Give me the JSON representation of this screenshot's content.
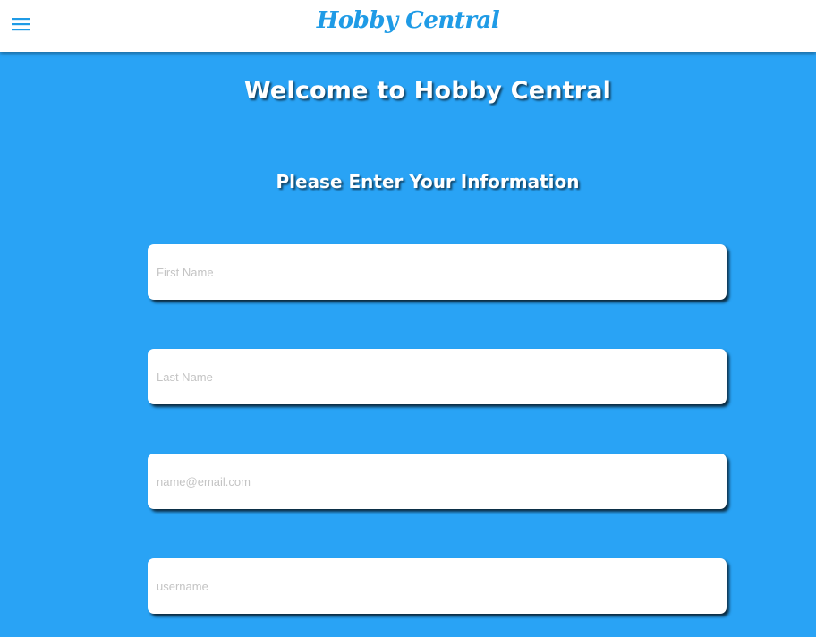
{
  "header": {
    "brand": "Hobby Central",
    "menu_icon": "menu-icon"
  },
  "main": {
    "welcome": "Welcome to Hobby Central",
    "subtitle": "Please Enter Your Information"
  },
  "form": {
    "first_name": {
      "placeholder": "First Name",
      "value": ""
    },
    "last_name": {
      "placeholder": "Last Name",
      "value": ""
    },
    "email": {
      "placeholder": "name@email.com",
      "value": ""
    },
    "username": {
      "placeholder": "username",
      "value": ""
    }
  },
  "colors": {
    "background": "#29a3f5",
    "brand": "#1f9be6",
    "header_bg": "#ffffff"
  }
}
